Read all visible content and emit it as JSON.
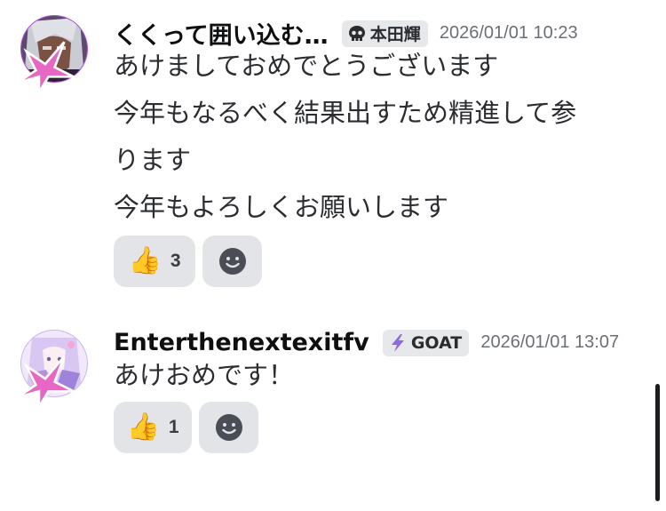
{
  "messages": [
    {
      "username": "くくって囲い込む…",
      "role": {
        "icon": "skull-icon",
        "label": "本田輝"
      },
      "timestamp": "2026/01/01 10:23",
      "lines": [
        "あけましておめでとうございます",
        "今年もなるべく結果出すため精進して参",
        "ります",
        "今年もよろしくお願いします"
      ],
      "reactions": [
        {
          "emoji": "👍",
          "count": "3"
        }
      ]
    },
    {
      "username": "Enterthenextexitfv",
      "role": {
        "icon": "lightning-icon",
        "label": "GOAT"
      },
      "timestamp": "2026/01/01 13:07",
      "lines": [
        "あけおめです！"
      ],
      "reactions": [
        {
          "emoji": "👍",
          "count": "1"
        }
      ]
    }
  ],
  "colors": {
    "reaction_bg": "#e3e4e7",
    "tag_bg": "#e7e8ea",
    "timestamp": "#6b6f76",
    "decor_pink": "#e667c4"
  }
}
